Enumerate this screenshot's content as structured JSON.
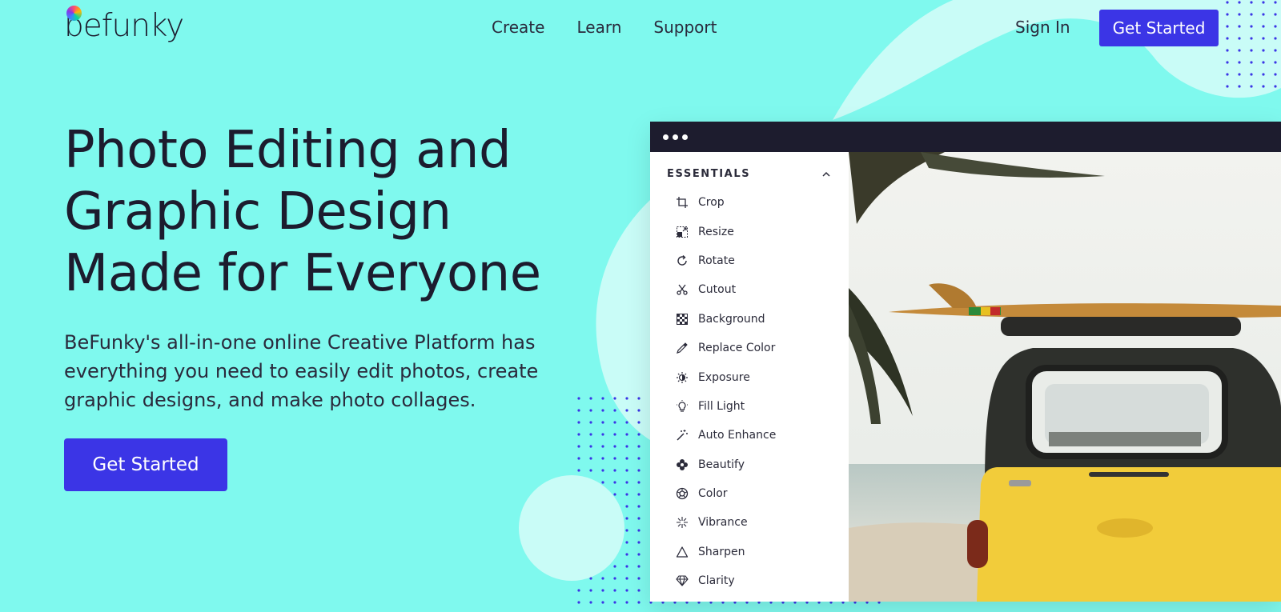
{
  "brand": {
    "logo_text": "befunky"
  },
  "nav": {
    "links": [
      "Create",
      "Learn",
      "Support"
    ],
    "sign_in": "Sign In",
    "cta": "Get Started"
  },
  "hero": {
    "title_line1": "Photo Editing and",
    "title_line2": "Graphic Design",
    "title_line3": "Made for Everyone",
    "subtitle": "BeFunky's all-in-one online Creative Platform has everything you need to easily edit photos, create graphic designs, and make photo collages.",
    "cta": "Get Started"
  },
  "editor": {
    "panel_title": "ESSENTIALS",
    "tools": [
      {
        "label": "Crop",
        "icon": "crop-icon"
      },
      {
        "label": "Resize",
        "icon": "resize-icon"
      },
      {
        "label": "Rotate",
        "icon": "rotate-icon"
      },
      {
        "label": "Cutout",
        "icon": "scissors-icon"
      },
      {
        "label": "Background",
        "icon": "checkerboard-icon"
      },
      {
        "label": "Replace Color",
        "icon": "eyedropper-icon"
      },
      {
        "label": "Exposure",
        "icon": "sun-half-icon"
      },
      {
        "label": "Fill Light",
        "icon": "lightbulb-icon"
      },
      {
        "label": "Auto Enhance",
        "icon": "magic-wand-icon"
      },
      {
        "label": "Beautify",
        "icon": "flower-icon"
      },
      {
        "label": "Color",
        "icon": "aperture-icon"
      },
      {
        "label": "Vibrance",
        "icon": "sparkle-icon"
      },
      {
        "label": "Sharpen",
        "icon": "triangle-icon"
      },
      {
        "label": "Clarity",
        "icon": "diamond-icon"
      }
    ]
  },
  "colors": {
    "background": "#7ff9ee",
    "accent": "#3b35e6",
    "dark": "#1d1c2e"
  }
}
